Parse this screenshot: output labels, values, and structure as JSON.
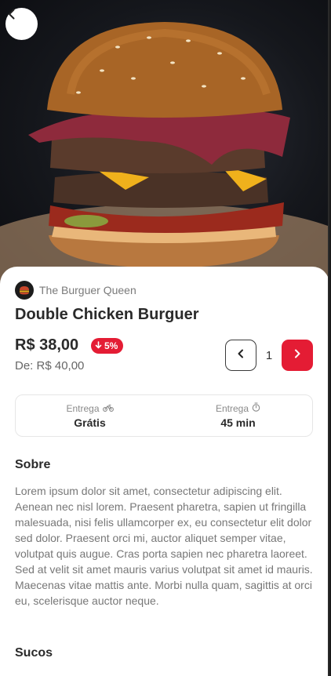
{
  "nav": {
    "back_icon": "chevron-left-icon"
  },
  "hero": {
    "image_subject": "burger"
  },
  "store": {
    "name": "The Burguer Queen",
    "logo_icon": "store-logo"
  },
  "product": {
    "title": "Double Chicken Burguer",
    "price": "R$ 38,00",
    "discount": "5%",
    "old_price": "De: R$ 40,00"
  },
  "quantity": {
    "value": "1"
  },
  "delivery": {
    "fee_label": "Entrega",
    "fee_value": "Grátis",
    "time_label": "Entrega",
    "time_value": "45 min"
  },
  "about": {
    "title": "Sobre",
    "text": "Lorem ipsum dolor sit amet, consectetur adipiscing elit. Aenean nec nisl lorem. Praesent pharetra, sapien ut fringilla malesuada, nisi felis ullamcorper ex, eu consectetur elit dolor sed dolor. Praesent orci mi, auctor aliquet semper vitae, volutpat quis augue. Cras porta sapien nec pharetra laoreet. Sed at velit sit amet mauris varius volutpat sit amet id mauris. Maecenas vitae mattis ante. Morbi nulla quam, sagittis at orci eu, scelerisque auctor neque."
  },
  "juices": {
    "title": "Sucos"
  },
  "colors": {
    "accent": "#e41c34",
    "text": "#2a2a2a",
    "muted": "#777777"
  }
}
